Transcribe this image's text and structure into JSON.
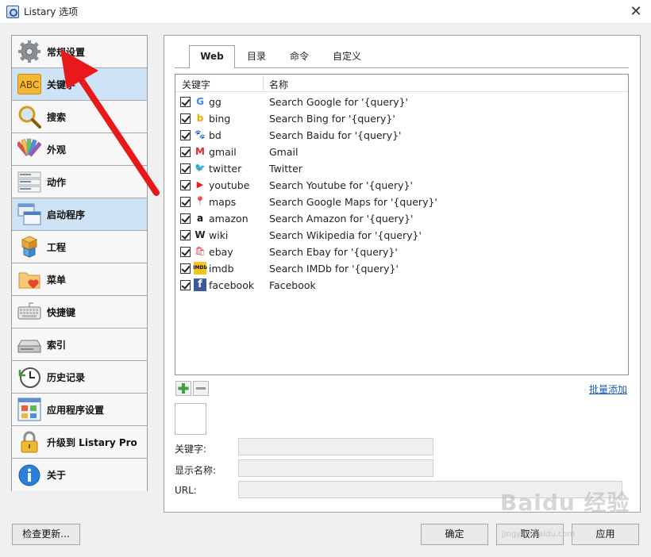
{
  "window": {
    "title": "Listary 选项",
    "close_glyph": "✕"
  },
  "sidebar": {
    "items": [
      {
        "label": "常规设置",
        "icon": "gear-icon",
        "selected": false
      },
      {
        "label": "关键字",
        "icon": "abc-icon",
        "selected": true
      },
      {
        "label": "搜索",
        "icon": "magnifier-icon",
        "selected": false
      },
      {
        "label": "外观",
        "icon": "palette-icon",
        "selected": false
      },
      {
        "label": "动作",
        "icon": "actions-icon",
        "selected": false
      },
      {
        "label": "启动程序",
        "icon": "windows-icon",
        "selected": true
      },
      {
        "label": "工程",
        "icon": "cubes-icon",
        "selected": false
      },
      {
        "label": "菜单",
        "icon": "folder-heart-icon",
        "selected": false
      },
      {
        "label": "快捷键",
        "icon": "keyboard-icon",
        "selected": false
      },
      {
        "label": "索引",
        "icon": "drive-icon",
        "selected": false
      },
      {
        "label": "历史记录",
        "icon": "clock-icon",
        "selected": false
      },
      {
        "label": "应用程序设置",
        "icon": "app-grid-icon",
        "selected": false
      },
      {
        "label": "升级到 Listary Pro",
        "icon": "lock-icon",
        "selected": false
      },
      {
        "label": "关于",
        "icon": "info-icon",
        "selected": false
      }
    ]
  },
  "tabs": [
    {
      "label": "Web",
      "active": true
    },
    {
      "label": "目录",
      "active": false
    },
    {
      "label": "命令",
      "active": false
    },
    {
      "label": "自定义",
      "active": false
    }
  ],
  "list": {
    "col_keyword": "关键字",
    "col_name": "名称",
    "rows": [
      {
        "key": "gg",
        "name": "Search Google for '{query}'",
        "icon": "google-icon",
        "glyph": "G",
        "color": "#4285f4",
        "checked": true
      },
      {
        "key": "bing",
        "name": "Search Bing for '{query}'",
        "icon": "bing-icon",
        "glyph": "b",
        "color": "#f2a900",
        "checked": true
      },
      {
        "key": "bd",
        "name": "Search Baidu for '{query}'",
        "icon": "baidu-icon",
        "glyph": "🐾",
        "color": "#2932e1",
        "checked": true
      },
      {
        "key": "gmail",
        "name": "Gmail",
        "icon": "gmail-icon",
        "glyph": "M",
        "color": "#d93025",
        "checked": true
      },
      {
        "key": "twitter",
        "name": "Twitter",
        "icon": "twitter-icon",
        "glyph": "🐦",
        "color": "#1da1f2",
        "checked": true
      },
      {
        "key": "youtube",
        "name": "Search Youtube for '{query}'",
        "icon": "youtube-icon",
        "glyph": "▶",
        "color": "#e62117",
        "checked": true
      },
      {
        "key": "maps",
        "name": "Search Google Maps for '{query}'",
        "icon": "maps-icon",
        "glyph": "📍",
        "color": "#34a853",
        "checked": true
      },
      {
        "key": "amazon",
        "name": "Search Amazon for '{query}'",
        "icon": "amazon-icon",
        "glyph": "a",
        "color": "#111111",
        "checked": true
      },
      {
        "key": "wiki",
        "name": "Search Wikipedia for '{query}'",
        "icon": "wikipedia-icon",
        "glyph": "W",
        "color": "#222222",
        "checked": true
      },
      {
        "key": "ebay",
        "name": "Search Ebay for '{query}'",
        "icon": "ebay-icon",
        "glyph": "🛍",
        "color": "#e53238",
        "checked": true
      },
      {
        "key": "imdb",
        "name": "Search IMDb for '{query}'",
        "icon": "imdb-icon",
        "glyph": "IMDb",
        "color": "#f5c518",
        "checked": true
      },
      {
        "key": "facebook",
        "name": "Facebook",
        "icon": "facebook-icon",
        "glyph": "f",
        "color": "#3b5998",
        "checked": true
      }
    ]
  },
  "toolbar": {
    "add_glyph": "+",
    "remove_glyph": "−",
    "bulk_add": "批量添加"
  },
  "form": {
    "keyword_label": "关键字:",
    "display_name_label": "显示名称:",
    "url_label": "URL:"
  },
  "buttons": {
    "check_updates": "检查更新...",
    "ok": "确定",
    "cancel": "取消",
    "apply": "应用"
  },
  "watermark": {
    "text": "Baidu 经验",
    "sub": "jingyan.baidu.com"
  },
  "colors": {
    "accent_arrow": "#e8191b",
    "selected_bg": "#cfe3f6",
    "link": "#1a5fb4"
  }
}
